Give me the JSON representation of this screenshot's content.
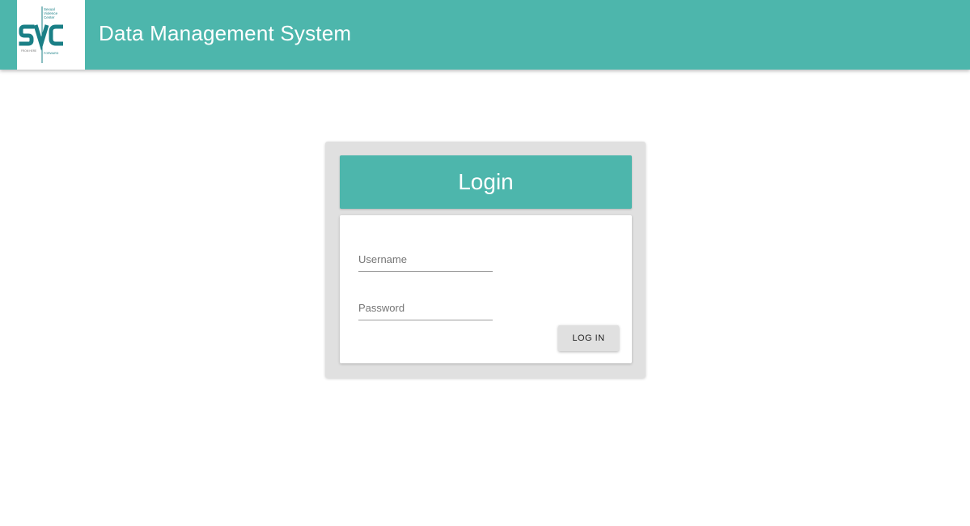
{
  "header": {
    "title": "Data Management System",
    "background_color": "#4db6ac",
    "logo": {
      "letters": "SVC",
      "tagline_top": "Sexual Violence Center",
      "tagline_left": "FROM HERE",
      "tagline_right": "FORWARD",
      "color": "#1a7f86"
    }
  },
  "login": {
    "title": "Login",
    "username": {
      "placeholder": "Username",
      "value": ""
    },
    "password": {
      "placeholder": "Password",
      "value": ""
    },
    "submit_label": "LOG IN",
    "accent_color": "#4db6ac",
    "panel_color": "#e0e0e0"
  }
}
